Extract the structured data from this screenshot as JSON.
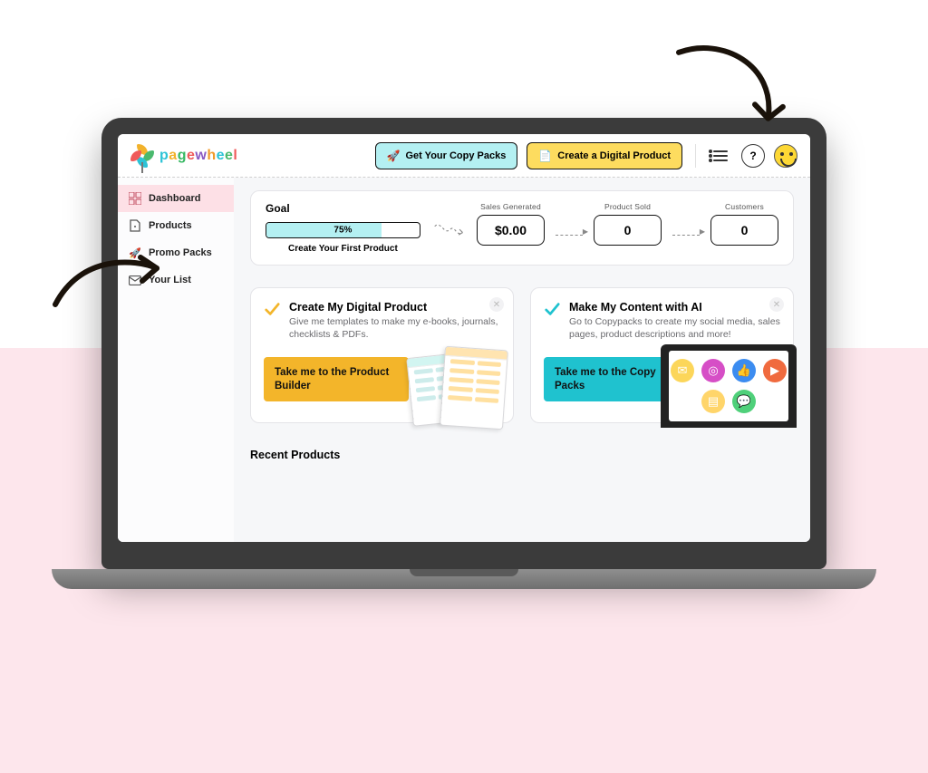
{
  "brand": "pagewheel",
  "header": {
    "copy_packs_label": "Get Your Copy Packs",
    "create_product_label": "Create a Digital Product"
  },
  "sidebar": {
    "items": [
      {
        "label": "Dashboard",
        "icon": "grid"
      },
      {
        "label": "Products",
        "icon": "file"
      },
      {
        "label": "Promo Packs",
        "icon": "rocket"
      },
      {
        "label": "Your List",
        "icon": "mail"
      }
    ]
  },
  "goal": {
    "title": "Goal",
    "progress_percent": "75%",
    "progress_value": 75,
    "subtitle": "Create Your First Product",
    "stats": [
      {
        "label": "Sales Generated",
        "value": "$0.00"
      },
      {
        "label": "Product Sold",
        "value": "0"
      },
      {
        "label": "Customers",
        "value": "0"
      }
    ]
  },
  "cards": {
    "product": {
      "title": "Create My Digital Product",
      "desc": "Give me templates to make my e-books, journals, checklists & PDFs.",
      "cta": "Take me to the Product Builder",
      "check_color": "#f3b52a"
    },
    "ai": {
      "title": "Make My Content with AI",
      "desc": "Go to Copypacks to create my social media, sales pages, product descriptions and more!",
      "cta": "Take me to the Copy Packs",
      "check_color": "#1fc2cf"
    }
  },
  "recent_products_title": "Recent Products"
}
